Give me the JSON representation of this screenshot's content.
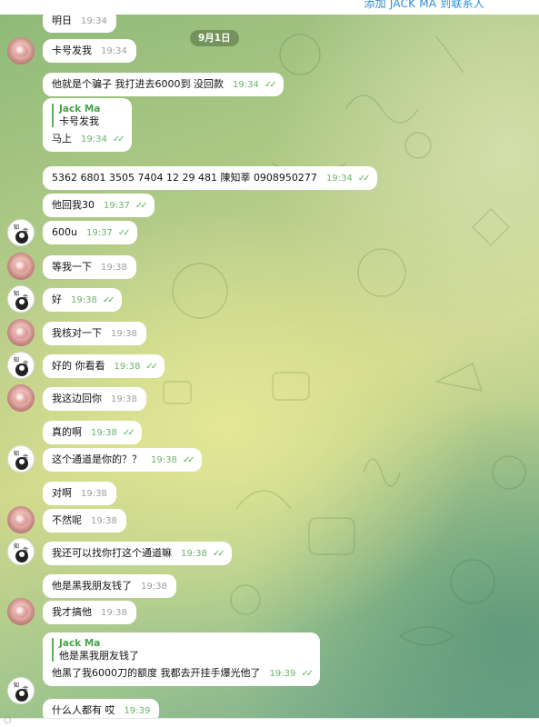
{
  "header": {
    "add_contact": "添加 JACK MA 到联系人"
  },
  "date_pill": "9月1日",
  "colors": {
    "bubble": "#ffffff",
    "quote_accent": "#4aa14a",
    "time_out": "#6bb36b",
    "tick": "#5ab45a",
    "link": "#2a8ed6"
  },
  "messages": [
    {
      "text": "明日",
      "time": "19:34",
      "dir": "in",
      "read": false
    },
    {
      "text": "卡号发我",
      "time": "19:34",
      "dir": "in",
      "read": false
    },
    {
      "text": "他就是个骗子  我打进去6000到 没回款",
      "time": "19:34",
      "dir": "out",
      "read": true
    },
    {
      "text": "5362 6801 3505 7404  12 29  481  陳知莘  0908950277",
      "time": "19:34",
      "dir": "out",
      "read": true
    },
    {
      "text": "他回我30",
      "time": "19:37",
      "dir": "out",
      "read": true
    },
    {
      "text": "600u",
      "time": "19:37",
      "dir": "out",
      "read": true
    },
    {
      "text": "等我一下",
      "time": "19:38",
      "dir": "in",
      "read": false
    },
    {
      "text": "好",
      "time": "19:38",
      "dir": "out",
      "read": true
    },
    {
      "text": "我核对一下",
      "time": "19:38",
      "dir": "in",
      "read": false
    },
    {
      "text": "好的 你看看",
      "time": "19:38",
      "dir": "out",
      "read": true
    },
    {
      "text": "我这边回你",
      "time": "19:38",
      "dir": "in",
      "read": false
    },
    {
      "text": "真的啊",
      "time": "19:38",
      "dir": "out",
      "read": true
    },
    {
      "text": "这个通道是你的？？",
      "time": "19:38",
      "dir": "out",
      "read": true
    },
    {
      "text": "对啊",
      "time": "19:38",
      "dir": "in",
      "read": false
    },
    {
      "text": "不然呢",
      "time": "19:38",
      "dir": "in",
      "read": false
    },
    {
      "text": "我还可以找你打这个通道嘛",
      "time": "19:38",
      "dir": "out",
      "read": true
    },
    {
      "text": "他是黑我朋友钱了",
      "time": "19:38",
      "dir": "in",
      "read": false
    },
    {
      "text": "我才搞他",
      "time": "19:38",
      "dir": "in",
      "read": false
    },
    {
      "text": "什么人都有  哎",
      "time": "19:39",
      "dir": "out",
      "read": true
    }
  ],
  "replies": [
    {
      "quote_name": "Jack Ma",
      "quote_text": "卡号发我",
      "text": "马上",
      "time": "19:34",
      "read": true
    },
    {
      "quote_name": "Jack Ma",
      "quote_text": "他是黑我朋友钱了",
      "text": "他黑了我6000刀的额度 我都去开挂手爆光他了",
      "time": "19:39",
      "read": true
    }
  ]
}
